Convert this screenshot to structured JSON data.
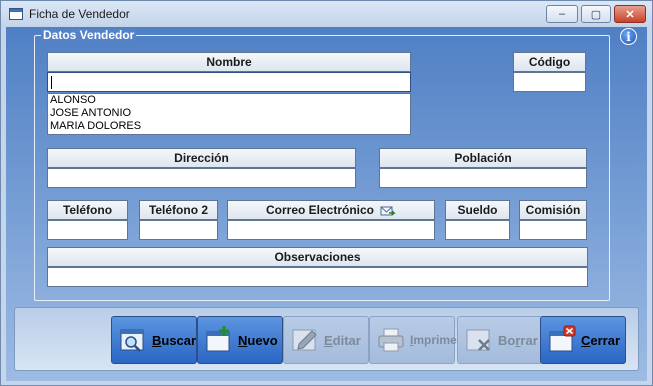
{
  "window": {
    "title": "Ficha de Vendedor",
    "controls": {
      "minimize": "‒",
      "maximize": "▢",
      "close": "✕"
    }
  },
  "group": {
    "title": "Datos Vendedor"
  },
  "fields": {
    "nombre": {
      "label": "Nombre",
      "value": ""
    },
    "codigo": {
      "label": "Código",
      "value": ""
    },
    "direccion": {
      "label": "Dirección",
      "value": ""
    },
    "poblacion": {
      "label": "Población",
      "value": ""
    },
    "telefono": {
      "label": "Teléfono",
      "value": ""
    },
    "telefono2": {
      "label": "Teléfono 2",
      "value": ""
    },
    "correo": {
      "label": "Correo Electrónico",
      "value": ""
    },
    "sueldo": {
      "label": "Sueldo",
      "value": ""
    },
    "comision": {
      "label": "Comisión",
      "value": ""
    },
    "observaciones": {
      "label": "Observaciones",
      "value": ""
    }
  },
  "nombre_list": [
    "ALONSO",
    "JOSE ANTONIO",
    "MARIA DOLORES"
  ],
  "toolbar": {
    "buscar": {
      "mnemonic": "B",
      "rest": "uscar",
      "enabled": true
    },
    "nuevo": {
      "mnemonic": "N",
      "rest": "uevo",
      "enabled": true
    },
    "editar": {
      "mnemonic": "E",
      "rest": "ditar",
      "enabled": false
    },
    "imprime": {
      "mnemonic": "I",
      "rest": "mprime",
      "enabled": false
    },
    "borrar": {
      "pre": "Bo",
      "mnemonic": "r",
      "rest": "rar",
      "enabled": false
    },
    "cerrar": {
      "mnemonic": "C",
      "rest": "errar",
      "enabled": true
    }
  },
  "icons": {
    "app": "window-icon",
    "info": "info-icon",
    "mail": "mail-send-icon",
    "buscar": "search-icon",
    "nuevo": "new-document-icon",
    "editar": "edit-pencil-icon",
    "imprime": "printer-icon",
    "borrar": "delete-icon",
    "cerrar": "close-window-icon"
  },
  "colors": {
    "client_top": "#4f7fc4",
    "client_bottom": "#9dbbe3",
    "button_enabled": "#2a66c4",
    "button_disabled": "#a3bbdc",
    "close_red": "#c8432a"
  }
}
